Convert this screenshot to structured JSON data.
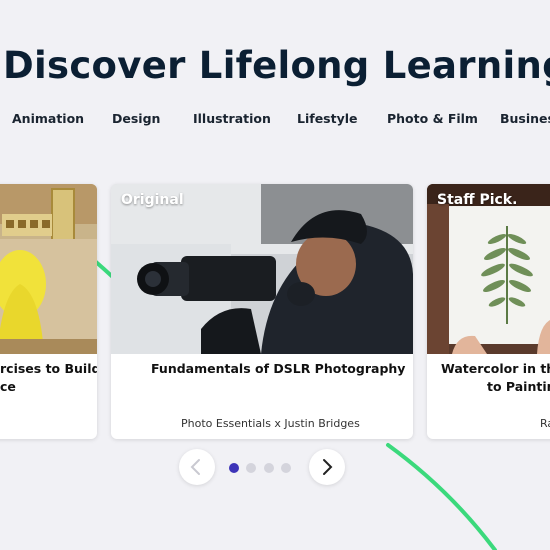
{
  "header": {
    "title": "Discover Lifelong Learning"
  },
  "categories": [
    "Animation",
    "Design",
    "Illustration",
    "Lifestyle",
    "Photo & Film",
    "Business"
  ],
  "cards": [
    {
      "badge": "",
      "title_line1": "rcises to Build",
      "title_line2": "ce",
      "author": ""
    },
    {
      "badge": "Original",
      "title_line1": "Fundamentals of DSLR Photography",
      "title_line2": "",
      "author": "Photo Essentials x Justin Bridges"
    },
    {
      "badge": "Staff Pick.",
      "title_line1": "Watercolor in the",
      "title_line2": "to Painting",
      "author": "Ra"
    }
  ],
  "carousel": {
    "prev_icon": "chevron-left-icon",
    "next_icon": "chevron-right-icon",
    "page_count": 4,
    "active_page": 1
  },
  "colors": {
    "background": "#f1f1f5",
    "title": "#0b1f33",
    "accent_green": "#3bd97c",
    "active_dot": "#3d34b8"
  }
}
